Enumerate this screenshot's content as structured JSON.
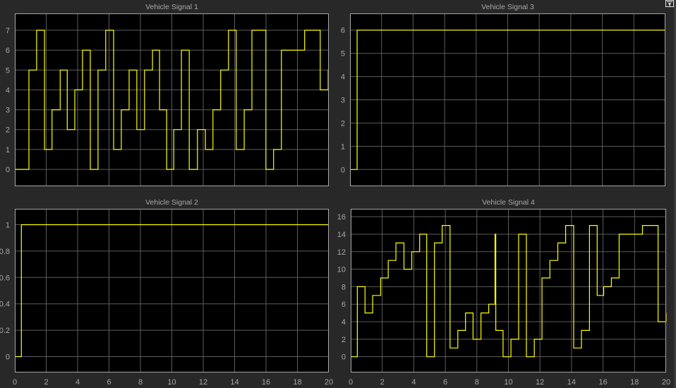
{
  "colors": {
    "background": "#282828",
    "axes": "#000000",
    "grid": "#5c5c5c",
    "frame": "#a6a6a6",
    "text": "#a8a8a8",
    "line": "#ffff00"
  },
  "toolbar": {
    "undock_icon": "undock-icon"
  },
  "chart_data": [
    {
      "type": "line",
      "step": true,
      "title": "Vehicle Signal 1",
      "xlim": [
        0,
        20
      ],
      "ylim": [
        -0.85,
        7.85
      ],
      "xticks": [
        0,
        2,
        4,
        6,
        8,
        10,
        12,
        14,
        16,
        18,
        20
      ],
      "show_xtick_labels": false,
      "yticks": [
        0,
        1,
        2,
        3,
        4,
        5,
        6,
        7
      ],
      "grid": true,
      "series": [
        {
          "name": "Vehicle Signal 1",
          "t": [
            0,
            0.9,
            1.39,
            1.89,
            2.37,
            2.89,
            3.34,
            3.82,
            4.31,
            4.81,
            5.3,
            5.79,
            6.29,
            6.78,
            7.28,
            7.77,
            8.26,
            8.77,
            9.22,
            9.67,
            10.12,
            10.61,
            11.11,
            11.63,
            12.14,
            12.62,
            13.11,
            13.61,
            14.1,
            14.61,
            15.1,
            15.99,
            16.48,
            16.98,
            18.46,
            19.45,
            19.96
          ],
          "y": [
            0,
            5,
            7,
            1,
            3,
            5,
            2,
            4,
            6,
            0,
            5,
            7,
            1,
            3,
            5,
            2,
            5,
            6,
            3,
            0,
            2,
            6,
            0,
            2,
            1,
            3,
            5,
            7,
            1,
            3,
            7,
            0,
            1,
            6,
            7,
            4,
            5
          ]
        }
      ]
    },
    {
      "type": "line",
      "step": true,
      "title": "Vehicle Signal 2",
      "xlim": [
        0,
        20
      ],
      "ylim": [
        -0.12,
        1.12
      ],
      "xticks": [
        0,
        2,
        4,
        6,
        8,
        10,
        12,
        14,
        16,
        18,
        20
      ],
      "show_xtick_labels": true,
      "yticks": [
        0,
        0.2,
        0.4,
        0.6,
        0.8,
        1
      ],
      "grid": true,
      "series": [
        {
          "name": "Vehicle Signal 2",
          "t": [
            0,
            0.42
          ],
          "y": [
            0,
            1
          ]
        }
      ]
    },
    {
      "type": "line",
      "step": true,
      "title": "Vehicle Signal 3",
      "xlim": [
        0,
        20
      ],
      "ylim": [
        -0.72,
        6.72
      ],
      "xticks": [
        0,
        2,
        4,
        6,
        8,
        10,
        12,
        14,
        16,
        18,
        20
      ],
      "show_xtick_labels": false,
      "yticks": [
        0,
        1,
        2,
        3,
        4,
        5,
        6
      ],
      "grid": true,
      "series": [
        {
          "name": "Vehicle Signal 3",
          "t": [
            0,
            0.45
          ],
          "y": [
            0,
            6
          ]
        }
      ]
    },
    {
      "type": "line",
      "step": true,
      "title": "Vehicle Signal 4",
      "xlim": [
        0,
        20
      ],
      "ylim": [
        -1.8,
        16.9
      ],
      "xticks": [
        0,
        2,
        4,
        6,
        8,
        10,
        12,
        14,
        16,
        18,
        20
      ],
      "show_xtick_labels": true,
      "yticks": [
        0,
        2,
        4,
        6,
        8,
        10,
        12,
        14,
        16
      ],
      "grid": true,
      "series": [
        {
          "name": "Vehicle Signal 4",
          "t": [
            0,
            0.42,
            0.91,
            1.39,
            1.9,
            2.38,
            2.87,
            3.38,
            3.87,
            4.37,
            4.82,
            5.31,
            5.8,
            6.3,
            6.79,
            7.28,
            7.76,
            8.26,
            8.75,
            9.15,
            9.2,
            9.66,
            10.16,
            10.65,
            11.14,
            11.64,
            12.13,
            12.63,
            13.13,
            13.63,
            14.14,
            14.63,
            15.14,
            15.63,
            16.04,
            16.53,
            17.02,
            18.5,
            19.49,
            19.99
          ],
          "y": [
            0,
            8,
            5,
            7,
            9,
            11,
            13,
            10,
            12,
            14,
            0,
            13,
            15,
            1,
            3,
            5,
            2,
            5,
            6,
            14,
            3,
            0,
            2,
            14,
            0,
            2,
            9,
            11,
            13,
            15,
            1,
            3,
            15,
            7,
            8,
            9,
            14,
            15,
            4,
            5
          ]
        }
      ]
    }
  ]
}
